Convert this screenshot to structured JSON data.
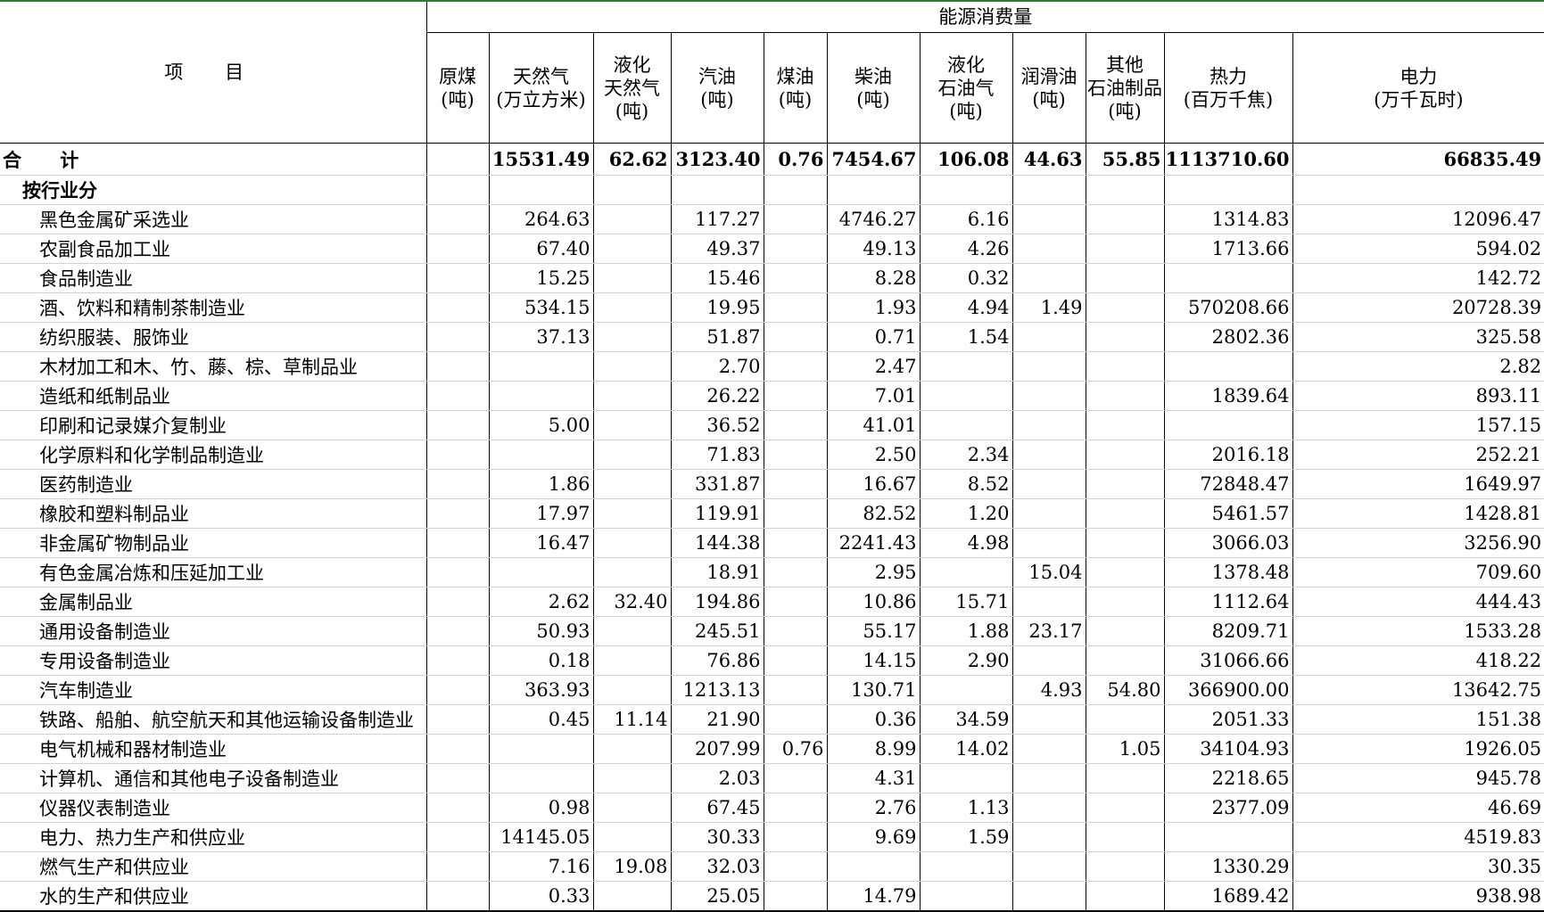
{
  "table": {
    "item_header": "项 目",
    "group_header": "能源消费量",
    "columns": [
      [
        "原煤",
        "(吨)"
      ],
      [
        "天然气",
        "(万立方米)"
      ],
      [
        "液化",
        "天然气",
        "(吨)"
      ],
      [
        "汽油",
        "(吨)"
      ],
      [
        "煤油",
        "(吨)"
      ],
      [
        "柴油",
        "(吨)"
      ],
      [
        "液化",
        "石油气",
        "(吨)"
      ],
      [
        "润滑油",
        "(吨)"
      ],
      [
        "其他",
        "石油制品",
        "(吨)"
      ],
      [
        "热力",
        "(百万千焦)"
      ],
      [
        "电力",
        "(万千瓦时)"
      ]
    ],
    "rows": [
      {
        "type": "total",
        "label": "合 计",
        "values": [
          "",
          "15531.49",
          "62.62",
          "3123.40",
          "0.76",
          "7454.67",
          "106.08",
          "44.63",
          "55.85",
          "1113710.60",
          "66835.49"
        ]
      },
      {
        "type": "section",
        "label": "按行业分",
        "values": [
          "",
          "",
          "",
          "",
          "",
          "",
          "",
          "",
          "",
          "",
          ""
        ]
      },
      {
        "type": "industry",
        "label": "黑色金属矿采选业",
        "values": [
          "",
          "264.63",
          "",
          "117.27",
          "",
          "4746.27",
          "6.16",
          "",
          "",
          "1314.83",
          "12096.47"
        ]
      },
      {
        "type": "industry",
        "label": "农副食品加工业",
        "values": [
          "",
          "67.40",
          "",
          "49.37",
          "",
          "49.13",
          "4.26",
          "",
          "",
          "1713.66",
          "594.02"
        ]
      },
      {
        "type": "industry",
        "label": "食品制造业",
        "values": [
          "",
          "15.25",
          "",
          "15.46",
          "",
          "8.28",
          "0.32",
          "",
          "",
          "",
          "142.72"
        ]
      },
      {
        "type": "industry",
        "label": "酒、饮料和精制茶制造业",
        "values": [
          "",
          "534.15",
          "",
          "19.95",
          "",
          "1.93",
          "4.94",
          "1.49",
          "",
          "570208.66",
          "20728.39"
        ]
      },
      {
        "type": "industry",
        "label": "纺织服装、服饰业",
        "values": [
          "",
          "37.13",
          "",
          "51.87",
          "",
          "0.71",
          "1.54",
          "",
          "",
          "2802.36",
          "325.58"
        ]
      },
      {
        "type": "industry",
        "label": "木材加工和木、竹、藤、棕、草制品业",
        "values": [
          "",
          "",
          "",
          "2.70",
          "",
          "2.47",
          "",
          "",
          "",
          "",
          "2.82"
        ]
      },
      {
        "type": "industry",
        "label": "造纸和纸制品业",
        "values": [
          "",
          "",
          "",
          "26.22",
          "",
          "7.01",
          "",
          "",
          "",
          "1839.64",
          "893.11"
        ]
      },
      {
        "type": "industry",
        "label": "印刷和记录媒介复制业",
        "values": [
          "",
          "5.00",
          "",
          "36.52",
          "",
          "41.01",
          "",
          "",
          "",
          "",
          "157.15"
        ]
      },
      {
        "type": "industry",
        "label": "化学原料和化学制品制造业",
        "values": [
          "",
          "",
          "",
          "71.83",
          "",
          "2.50",
          "2.34",
          "",
          "",
          "2016.18",
          "252.21"
        ]
      },
      {
        "type": "industry",
        "label": "医药制造业",
        "values": [
          "",
          "1.86",
          "",
          "331.87",
          "",
          "16.67",
          "8.52",
          "",
          "",
          "72848.47",
          "1649.97"
        ]
      },
      {
        "type": "industry",
        "label": "橡胶和塑料制品业",
        "values": [
          "",
          "17.97",
          "",
          "119.91",
          "",
          "82.52",
          "1.20",
          "",
          "",
          "5461.57",
          "1428.81"
        ]
      },
      {
        "type": "industry",
        "label": "非金属矿物制品业",
        "values": [
          "",
          "16.47",
          "",
          "144.38",
          "",
          "2241.43",
          "4.98",
          "",
          "",
          "3066.03",
          "3256.90"
        ]
      },
      {
        "type": "industry",
        "label": "有色金属冶炼和压延加工业",
        "values": [
          "",
          "",
          "",
          "18.91",
          "",
          "2.95",
          "",
          "15.04",
          "",
          "1378.48",
          "709.60"
        ]
      },
      {
        "type": "industry",
        "label": "金属制品业",
        "values": [
          "",
          "2.62",
          "32.40",
          "194.86",
          "",
          "10.86",
          "15.71",
          "",
          "",
          "1112.64",
          "444.43"
        ]
      },
      {
        "type": "industry",
        "label": "通用设备制造业",
        "values": [
          "",
          "50.93",
          "",
          "245.51",
          "",
          "55.17",
          "1.88",
          "23.17",
          "",
          "8209.71",
          "1533.28"
        ]
      },
      {
        "type": "industry",
        "label": "专用设备制造业",
        "values": [
          "",
          "0.18",
          "",
          "76.86",
          "",
          "14.15",
          "2.90",
          "",
          "",
          "31066.66",
          "418.22"
        ]
      },
      {
        "type": "industry",
        "label": "汽车制造业",
        "values": [
          "",
          "363.93",
          "",
          "1213.13",
          "",
          "130.71",
          "",
          "4.93",
          "54.80",
          "366900.00",
          "13642.75"
        ]
      },
      {
        "type": "industry",
        "label": "铁路、船舶、航空航天和其他运输设备制造业",
        "values": [
          "",
          "0.45",
          "11.14",
          "21.90",
          "",
          "0.36",
          "34.59",
          "",
          "",
          "2051.33",
          "151.38"
        ]
      },
      {
        "type": "industry",
        "label": "电气机械和器材制造业",
        "values": [
          "",
          "",
          "",
          "207.99",
          "0.76",
          "8.99",
          "14.02",
          "",
          "1.05",
          "34104.93",
          "1926.05"
        ]
      },
      {
        "type": "industry",
        "label": "计算机、通信和其他电子设备制造业",
        "values": [
          "",
          "",
          "",
          "2.03",
          "",
          "4.31",
          "",
          "",
          "",
          "2218.65",
          "945.78"
        ]
      },
      {
        "type": "industry",
        "label": "仪器仪表制造业",
        "values": [
          "",
          "0.98",
          "",
          "67.45",
          "",
          "2.76",
          "1.13",
          "",
          "",
          "2377.09",
          "46.69"
        ]
      },
      {
        "type": "industry",
        "label": "电力、热力生产和供应业",
        "values": [
          "",
          "14145.05",
          "",
          "30.33",
          "",
          "9.69",
          "1.59",
          "",
          "",
          "",
          "4519.83"
        ]
      },
      {
        "type": "industry",
        "label": "燃气生产和供应业",
        "values": [
          "",
          "7.16",
          "19.08",
          "32.03",
          "",
          "",
          "",
          "",
          "",
          "1330.29",
          "30.35"
        ]
      },
      {
        "type": "industry",
        "label": "水的生产和供应业",
        "values": [
          "",
          "0.33",
          "",
          "25.05",
          "",
          "14.79",
          "",
          "",
          "",
          "1689.42",
          "938.98"
        ]
      }
    ]
  }
}
